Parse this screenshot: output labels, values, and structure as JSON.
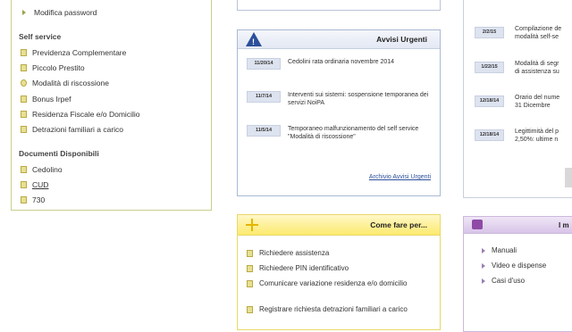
{
  "left_panel": {
    "top_link": "Modifica password",
    "self_service_title": "Self service",
    "self_service_items": [
      "Previdenza Complementare",
      "Piccolo Prestito",
      "Modalità di riscossione",
      "Bonus Irpef",
      "Residenza Fiscale e/o Domicilio",
      "Detrazioni familiari a carico"
    ],
    "documenti_title": "Documenti Disponibili",
    "documenti_items": [
      "Cedolino",
      "CUD",
      "730"
    ]
  },
  "avvisi": {
    "title": "Avvisi Urgenti",
    "items": [
      {
        "date": "11/20/14",
        "text": "Cedolini rata ordinaria novembre 2014"
      },
      {
        "date": "11/7/14",
        "text": "Interventi sui sistemi: sospensione temporanea dei servizi NoiPA"
      },
      {
        "date": "11/5/14",
        "text": "Temporaneo malfunzionamento del self service \"Modalità di riscossione\""
      }
    ],
    "archive_link": "Archivio Avvisi Urgenti"
  },
  "come_fare": {
    "title": "Come fare per...",
    "items": [
      "Richiedere assistenza",
      "Richiedere PIN identificativo",
      "Comunicare variazione residenza e/o domicilio",
      "Registrare richiesta detrazioni familiari a carico"
    ]
  },
  "right_news": {
    "items": [
      {
        "date": "2/2/15",
        "lines": [
          "Compilazione de",
          "modalità self-se"
        ]
      },
      {
        "date": "1/22/15",
        "lines": [
          "Modalità di segr",
          "di assistenza su"
        ]
      },
      {
        "date": "12/18/14",
        "lines": [
          "Orario del nume",
          "31 Dicembre"
        ]
      },
      {
        "date": "12/18/14",
        "lines": [
          "Legittimità del p",
          "2,50%: ultime n"
        ]
      }
    ]
  },
  "right_box": {
    "title": "I m",
    "items": [
      "Manuali",
      "Video e dispense",
      "Casi d'uso"
    ]
  },
  "colors": {
    "left_border": "#c9cf8e",
    "avvisi_accent": "#2c4f9b",
    "come_accent": "#fcea6e",
    "right_accent": "#8f4aa7"
  }
}
